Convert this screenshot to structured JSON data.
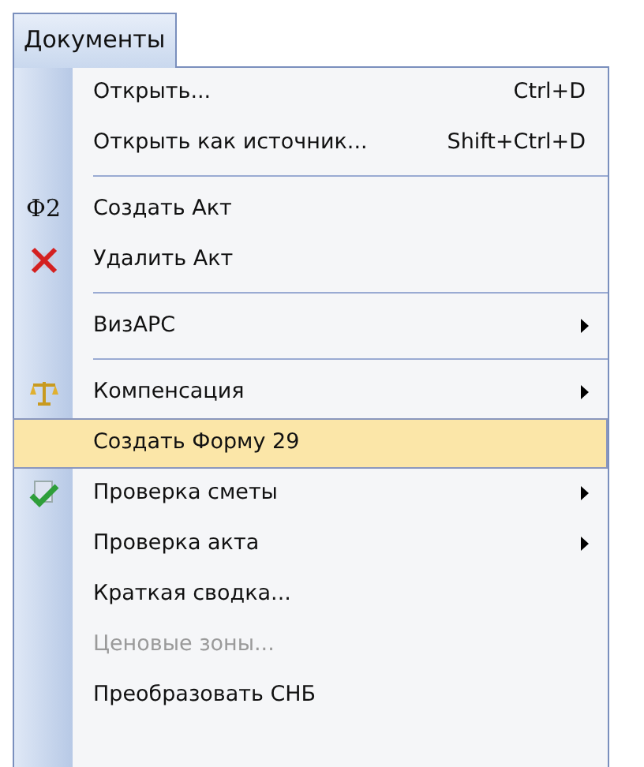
{
  "menu_title": "Документы",
  "items": [
    {
      "kind": "item",
      "label": "Открыть...",
      "shortcut": "Ctrl+D",
      "submenu": false,
      "selected": false,
      "disabled": false
    },
    {
      "kind": "item",
      "label": "Открыть как источник...",
      "shortcut": "Shift+Ctrl+D",
      "submenu": false,
      "selected": false,
      "disabled": false
    },
    {
      "kind": "separator"
    },
    {
      "kind": "item",
      "label": "Создать Акт",
      "icon_text": "Ф2",
      "submenu": false,
      "selected": false,
      "disabled": false
    },
    {
      "kind": "item",
      "label": "Удалить Акт",
      "submenu": false,
      "selected": false,
      "disabled": false
    },
    {
      "kind": "separator"
    },
    {
      "kind": "item",
      "label": "ВизАРС",
      "submenu": true,
      "selected": false,
      "disabled": false
    },
    {
      "kind": "separator"
    },
    {
      "kind": "item",
      "label": "Компенсация",
      "submenu": true,
      "selected": false,
      "disabled": false
    },
    {
      "kind": "item",
      "label": "Создать Форму 29",
      "submenu": false,
      "selected": true,
      "disabled": false
    },
    {
      "kind": "item",
      "label": "Проверка сметы",
      "submenu": true,
      "selected": false,
      "disabled": false
    },
    {
      "kind": "item",
      "label": "Проверка акта",
      "submenu": true,
      "selected": false,
      "disabled": false
    },
    {
      "kind": "item",
      "label": "Краткая сводка...",
      "submenu": false,
      "selected": false,
      "disabled": false
    },
    {
      "kind": "item",
      "label": "Ценовые зоны...",
      "submenu": false,
      "selected": false,
      "disabled": true
    },
    {
      "kind": "item",
      "label": "Преобразовать СНБ",
      "submenu": false,
      "selected": false,
      "disabled": false
    }
  ]
}
